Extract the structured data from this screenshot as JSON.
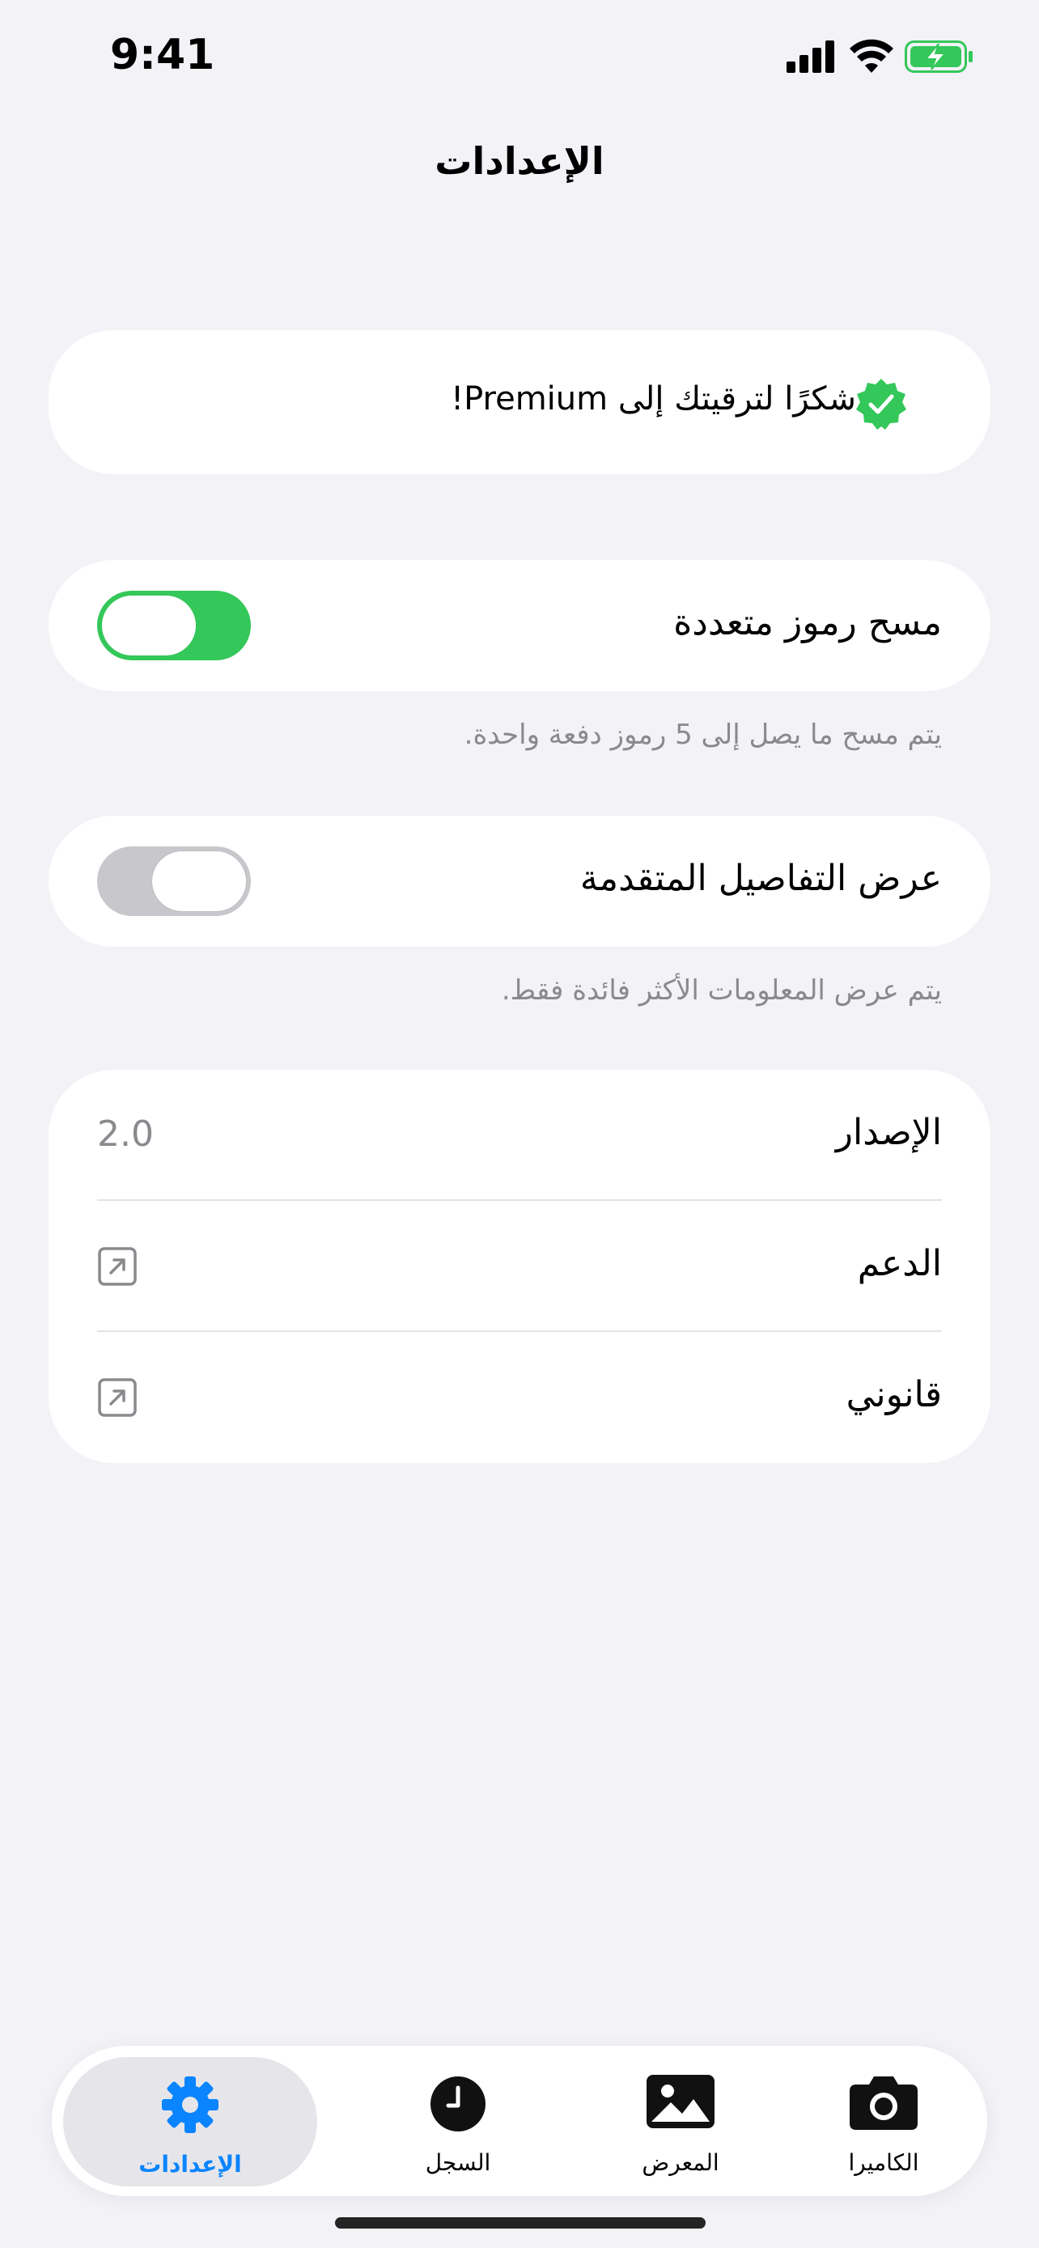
{
  "status_bar": {
    "time": "9:41"
  },
  "page": {
    "title": "الإعدادات"
  },
  "premium": {
    "text": "شكرًا لترقيتك إلى Premium!",
    "icon": "verified-check-icon",
    "accent": "#34c759"
  },
  "multi_scan": {
    "label": "مسح رموز متعددة",
    "enabled": true,
    "footnote": "يتم مسح ما يصل إلى 5 رموز دفعة واحدة."
  },
  "advanced_details": {
    "label": "عرض التفاصيل المتقدمة",
    "enabled": false,
    "footnote": "يتم عرض المعلومات الأكثر فائدة فقط."
  },
  "info": {
    "version_label": "الإصدار",
    "version_value": "2.0",
    "support_label": "الدعم",
    "legal_label": "قانوني"
  },
  "tabs": [
    {
      "label": "الكاميرا",
      "icon": "camera-icon"
    },
    {
      "label": "المعرض",
      "icon": "photo-icon"
    },
    {
      "label": "السجل",
      "icon": "clock-icon"
    },
    {
      "label": "الإعدادات",
      "icon": "gear-icon",
      "active": true
    }
  ],
  "colors": {
    "accent_blue": "#0a84ff",
    "toggle_on": "#34c759",
    "toggle_off": "#c7c7cc",
    "background": "#f2f2f7"
  }
}
